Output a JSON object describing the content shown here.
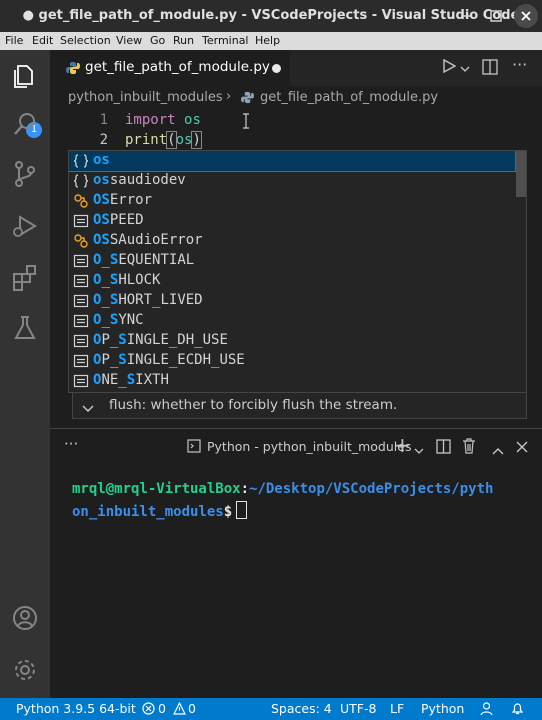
{
  "window": {
    "title": "● get_file_path_of_module.py - VSCodeProjects - Visual Studio Code"
  },
  "menu": [
    "File",
    "Edit",
    "Selection",
    "View",
    "Go",
    "Run",
    "Terminal",
    "Help"
  ],
  "activity_bar": {
    "explorer_badge": "1"
  },
  "tab": {
    "label": "get_file_path_of_module.py"
  },
  "breadcrumb": {
    "folder": "python_inbuilt_modules",
    "separator": "›",
    "file": "get_file_path_of_module.py"
  },
  "editor": {
    "lines": [
      {
        "number": "1",
        "keyword": "import",
        "module": "os"
      },
      {
        "number": "2",
        "func": "print",
        "open": "(",
        "arg": "os",
        "close": ")"
      }
    ]
  },
  "suggestions": [
    {
      "kind": "module",
      "match": "os",
      "rest": "",
      "selected": true
    },
    {
      "kind": "module",
      "match": "os",
      "rest": "saudiodev"
    },
    {
      "kind": "class",
      "match": "OS",
      "rest": "Error"
    },
    {
      "kind": "constant",
      "match": "OS",
      "rest": "PEED"
    },
    {
      "kind": "class",
      "match": "OS",
      "rest": "SAudioError"
    },
    {
      "kind": "constant",
      "segments": [
        [
          "O",
          1
        ],
        [
          "_",
          0
        ],
        [
          "S",
          1
        ],
        [
          "EQUENTIAL",
          0
        ]
      ]
    },
    {
      "kind": "constant",
      "segments": [
        [
          "O",
          1
        ],
        [
          "_",
          0
        ],
        [
          "S",
          1
        ],
        [
          "HLOCK",
          0
        ]
      ]
    },
    {
      "kind": "constant",
      "segments": [
        [
          "O",
          1
        ],
        [
          "_",
          0
        ],
        [
          "S",
          1
        ],
        [
          "HORT_LIVED",
          0
        ]
      ]
    },
    {
      "kind": "constant",
      "segments": [
        [
          "O",
          1
        ],
        [
          "_",
          0
        ],
        [
          "S",
          1
        ],
        [
          "YNC",
          0
        ]
      ]
    },
    {
      "kind": "constant",
      "segments": [
        [
          "O",
          1
        ],
        [
          "P_",
          0
        ],
        [
          "S",
          1
        ],
        [
          "INGLE_DH_USE",
          0
        ]
      ]
    },
    {
      "kind": "constant",
      "segments": [
        [
          "O",
          1
        ],
        [
          "P_",
          0
        ],
        [
          "S",
          1
        ],
        [
          "INGLE_ECDH_USE",
          0
        ]
      ]
    },
    {
      "kind": "constant",
      "segments": [
        [
          "O",
          1
        ],
        [
          "NE_",
          0
        ],
        [
          "S",
          1
        ],
        [
          "IXTH",
          0
        ]
      ]
    }
  ],
  "parameter_hint": {
    "text": "flush: whether to forcibly flush the stream."
  },
  "panel": {
    "more": "···",
    "terminal_name": "Python - python_inbuilt_modules",
    "prompt_user": "mrql@mrql-VirtualBox",
    "prompt_colon": ":",
    "prompt_path_1": "~/Desktop/VSCodeProjects/pyth",
    "prompt_path_2": "on_inbuilt_modules",
    "prompt_symbol": "$"
  },
  "status_bar": {
    "interpreter": "Python 3.9.5 64-bit",
    "errors": "0",
    "warnings": "0",
    "spaces": "Spaces: 4",
    "encoding": "UTF-8",
    "eol": "LF",
    "language": "Python"
  },
  "colors": {
    "status_bar": "#007acc",
    "selection": "#04395e",
    "match_highlight": "#18a3ff",
    "prompt_user": "#23d18b",
    "prompt_path": "#3b8eea"
  }
}
